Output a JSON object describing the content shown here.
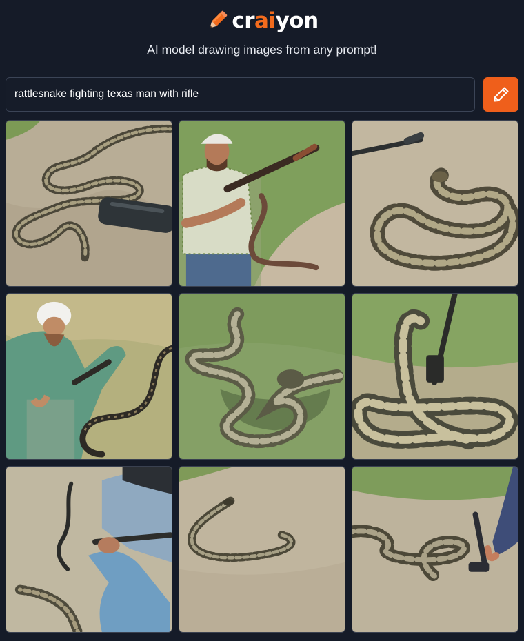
{
  "brand": {
    "name_prefix": "cr",
    "name_accent": "ai",
    "name_suffix": "yon",
    "logo_icon": "pencil-icon",
    "accent_color": "#f26b1d"
  },
  "tagline": "AI model drawing images from any prompt!",
  "search": {
    "value": "rattlesnake fighting texas man with rifle",
    "button_icon": "pencil-icon",
    "button_color": "#ef5f1b"
  },
  "results": {
    "count": 9,
    "images": [
      {
        "subject": "snake-and-rifle-on-dirt"
      },
      {
        "subject": "man-with-rifle-and-snake"
      },
      {
        "subject": "coiled-rattlesnake"
      },
      {
        "subject": "man-in-hat-with-snake"
      },
      {
        "subject": "rattlesnake-on-grass"
      },
      {
        "subject": "coiled-snake-with-rifle"
      },
      {
        "subject": "man-running-with-snake"
      },
      {
        "subject": "snake-on-sand"
      },
      {
        "subject": "snake-and-hand-with-rifle"
      }
    ]
  },
  "colors": {
    "background": "#151b28",
    "sand": "#b9ae95",
    "grass": "#7f9a55"
  }
}
